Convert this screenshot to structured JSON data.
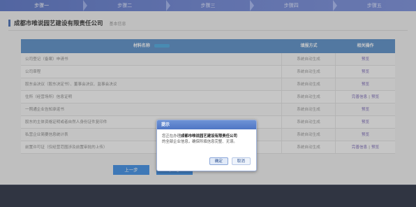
{
  "steps": [
    "步骤一",
    "步骤二",
    "步骤三",
    "步骤四",
    "步骤五"
  ],
  "page": {
    "company": "成都市唯说园艺建设有限责任公司",
    "subtitle": "基本信息"
  },
  "table": {
    "headers": [
      "材料名称",
      "填报方式",
      "相关操作"
    ],
    "rows": [
      {
        "name": "公司登记（备案）申请书",
        "method": "系统自动生成",
        "actions": [
          "预览"
        ]
      },
      {
        "name": "公司章程",
        "method": "系统自动生成",
        "actions": [
          "预览"
        ]
      },
      {
        "name": "股东会决议（股东决定书）、董事会决议、监事会决议",
        "method": "系统自动生成",
        "actions": [
          "预览"
        ]
      },
      {
        "name": "住所（经营场所）信息证明",
        "method": "系统自动生成",
        "actions": [
          "完善信息",
          "预览"
        ]
      },
      {
        "name": "一照通企业告知承诺书",
        "method": "系统自动生成",
        "actions": [
          "预览"
        ]
      },
      {
        "name": "股东的主体资格证明或者自然人身份证件复印件",
        "method": "系统自动生成",
        "actions": [
          "预览"
        ]
      },
      {
        "name": "私营企业简要信息统计表",
        "method": "系统自动生成",
        "actions": [
          "预览"
        ]
      },
      {
        "name": "前置许可证（仅经营范围涉及前置审批的上传）",
        "method": "系统自动生成",
        "actions": [
          "完善信息",
          "预览"
        ]
      }
    ]
  },
  "buttons": {
    "prev": "上一步",
    "next": "下一步"
  },
  "dialog": {
    "title": "提示",
    "line1_prefix": "您正在办理",
    "line1_company": "成都市唯说园艺建设有限责任公司",
    "line2": "的全部企业信息，确保所填信息完整、无误。",
    "ok": "确定",
    "cancel": "取消"
  },
  "colors": {
    "header": "#5a8fc8",
    "accent": "#3f8fe6",
    "link": "#7a68b8"
  }
}
